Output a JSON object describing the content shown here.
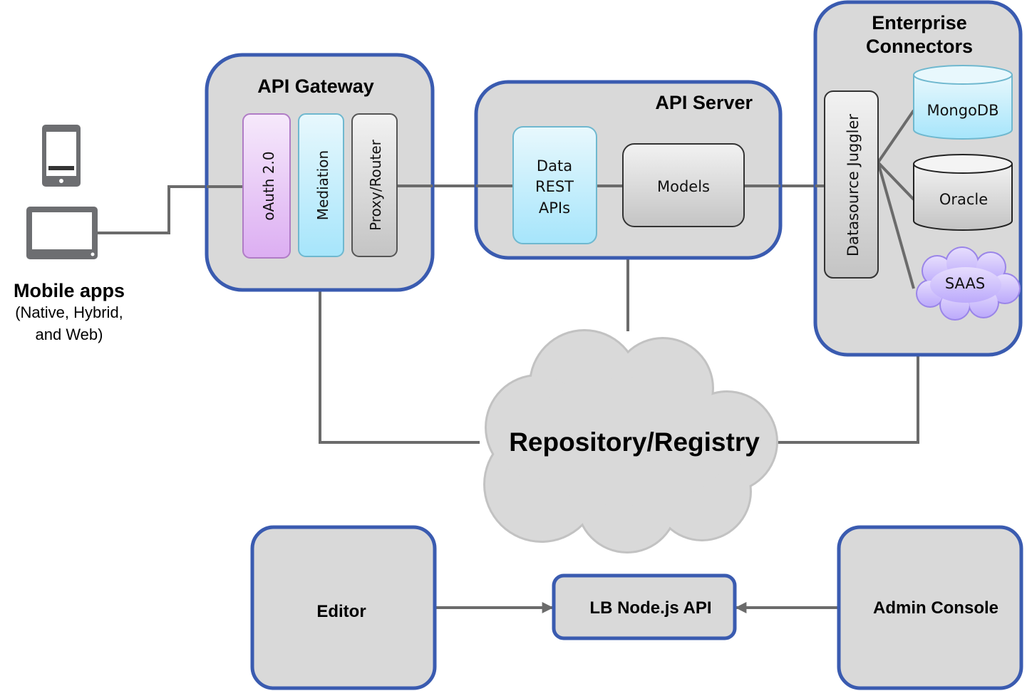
{
  "colors": {
    "panel_border": "#3a5bb0",
    "panel_fill": "#d9d9d9",
    "connector": "#6b6b6b",
    "oauth_fill": "#e4b8f2",
    "mediation_fill": "#b4e9fb",
    "proxy_fill": "#d0d0d0",
    "mongodb_fill": "#b4e9fb",
    "saas_fill": "#cbbcfb"
  },
  "mobile": {
    "title": "Mobile apps",
    "subtitle_line1": "(Native, Hybrid,",
    "subtitle_line2": "and Web)",
    "icons": [
      "phone-icon",
      "tablet-icon"
    ]
  },
  "gateway": {
    "title": "API Gateway",
    "modules": [
      "oAuth 2.0",
      "Mediation",
      "Proxy/Router"
    ]
  },
  "server": {
    "title": "API Server",
    "data_rest_lines": [
      "Data",
      "REST",
      "APIs"
    ],
    "models": "Models"
  },
  "connectors": {
    "title_line1": "Enterprise",
    "title_line2": "Connectors",
    "juggler": "Datasource Juggler",
    "sources": [
      "MongoDB",
      "Oracle",
      "SAAS"
    ]
  },
  "repository": {
    "label": "Repository/Registry"
  },
  "tools": {
    "editor": "Editor",
    "api": "LB Node.js API",
    "admin": "Admin Console"
  }
}
